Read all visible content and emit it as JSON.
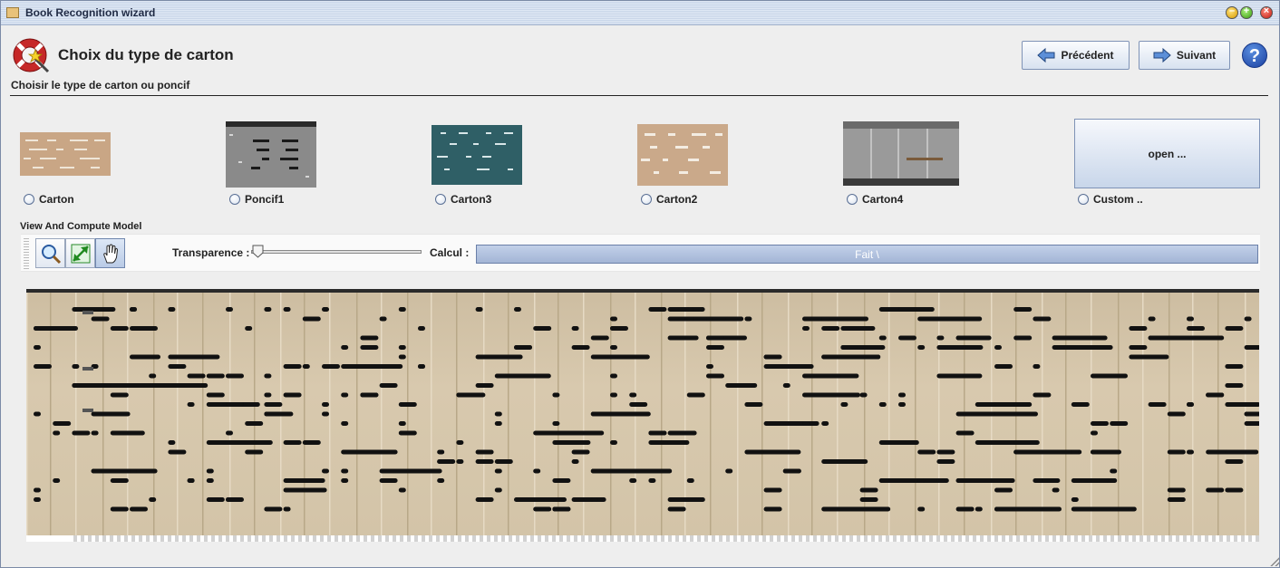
{
  "window": {
    "title": "Book Recognition wizard"
  },
  "header": {
    "title": "Choix du type de carton",
    "subtitle": "Choisir le type de carton ou poncif",
    "prev_label": "Précédent",
    "next_label": "Suivant",
    "help_label": "?"
  },
  "options": [
    {
      "label": "Carton",
      "thumb_color": "#c9a685"
    },
    {
      "label": "Poncif1",
      "thumb_color": "#7f7f7f"
    },
    {
      "label": "Carton3",
      "thumb_color": "#2f5f66"
    },
    {
      "label": "Carton2",
      "thumb_color": "#caa98a"
    },
    {
      "label": "Carton4",
      "thumb_color": "#8f8f8f"
    },
    {
      "label": "Custom ..",
      "button_label": "open ..."
    }
  ],
  "view": {
    "section_label": "View And Compute Model",
    "tools": [
      "zoom-tool",
      "fit-tool",
      "pan-tool"
    ],
    "active_tool": "pan-tool",
    "transparence_label": "Transparence :",
    "transparence_value": 0,
    "calcul_label": "Calcul :",
    "progress_text": "Fait  \\",
    "progress_value": 1
  },
  "colors": {
    "accent": "#1a3fa0",
    "carton": "#d3c4a8",
    "punch": "#111111",
    "progress": "#b4c4e0"
  }
}
